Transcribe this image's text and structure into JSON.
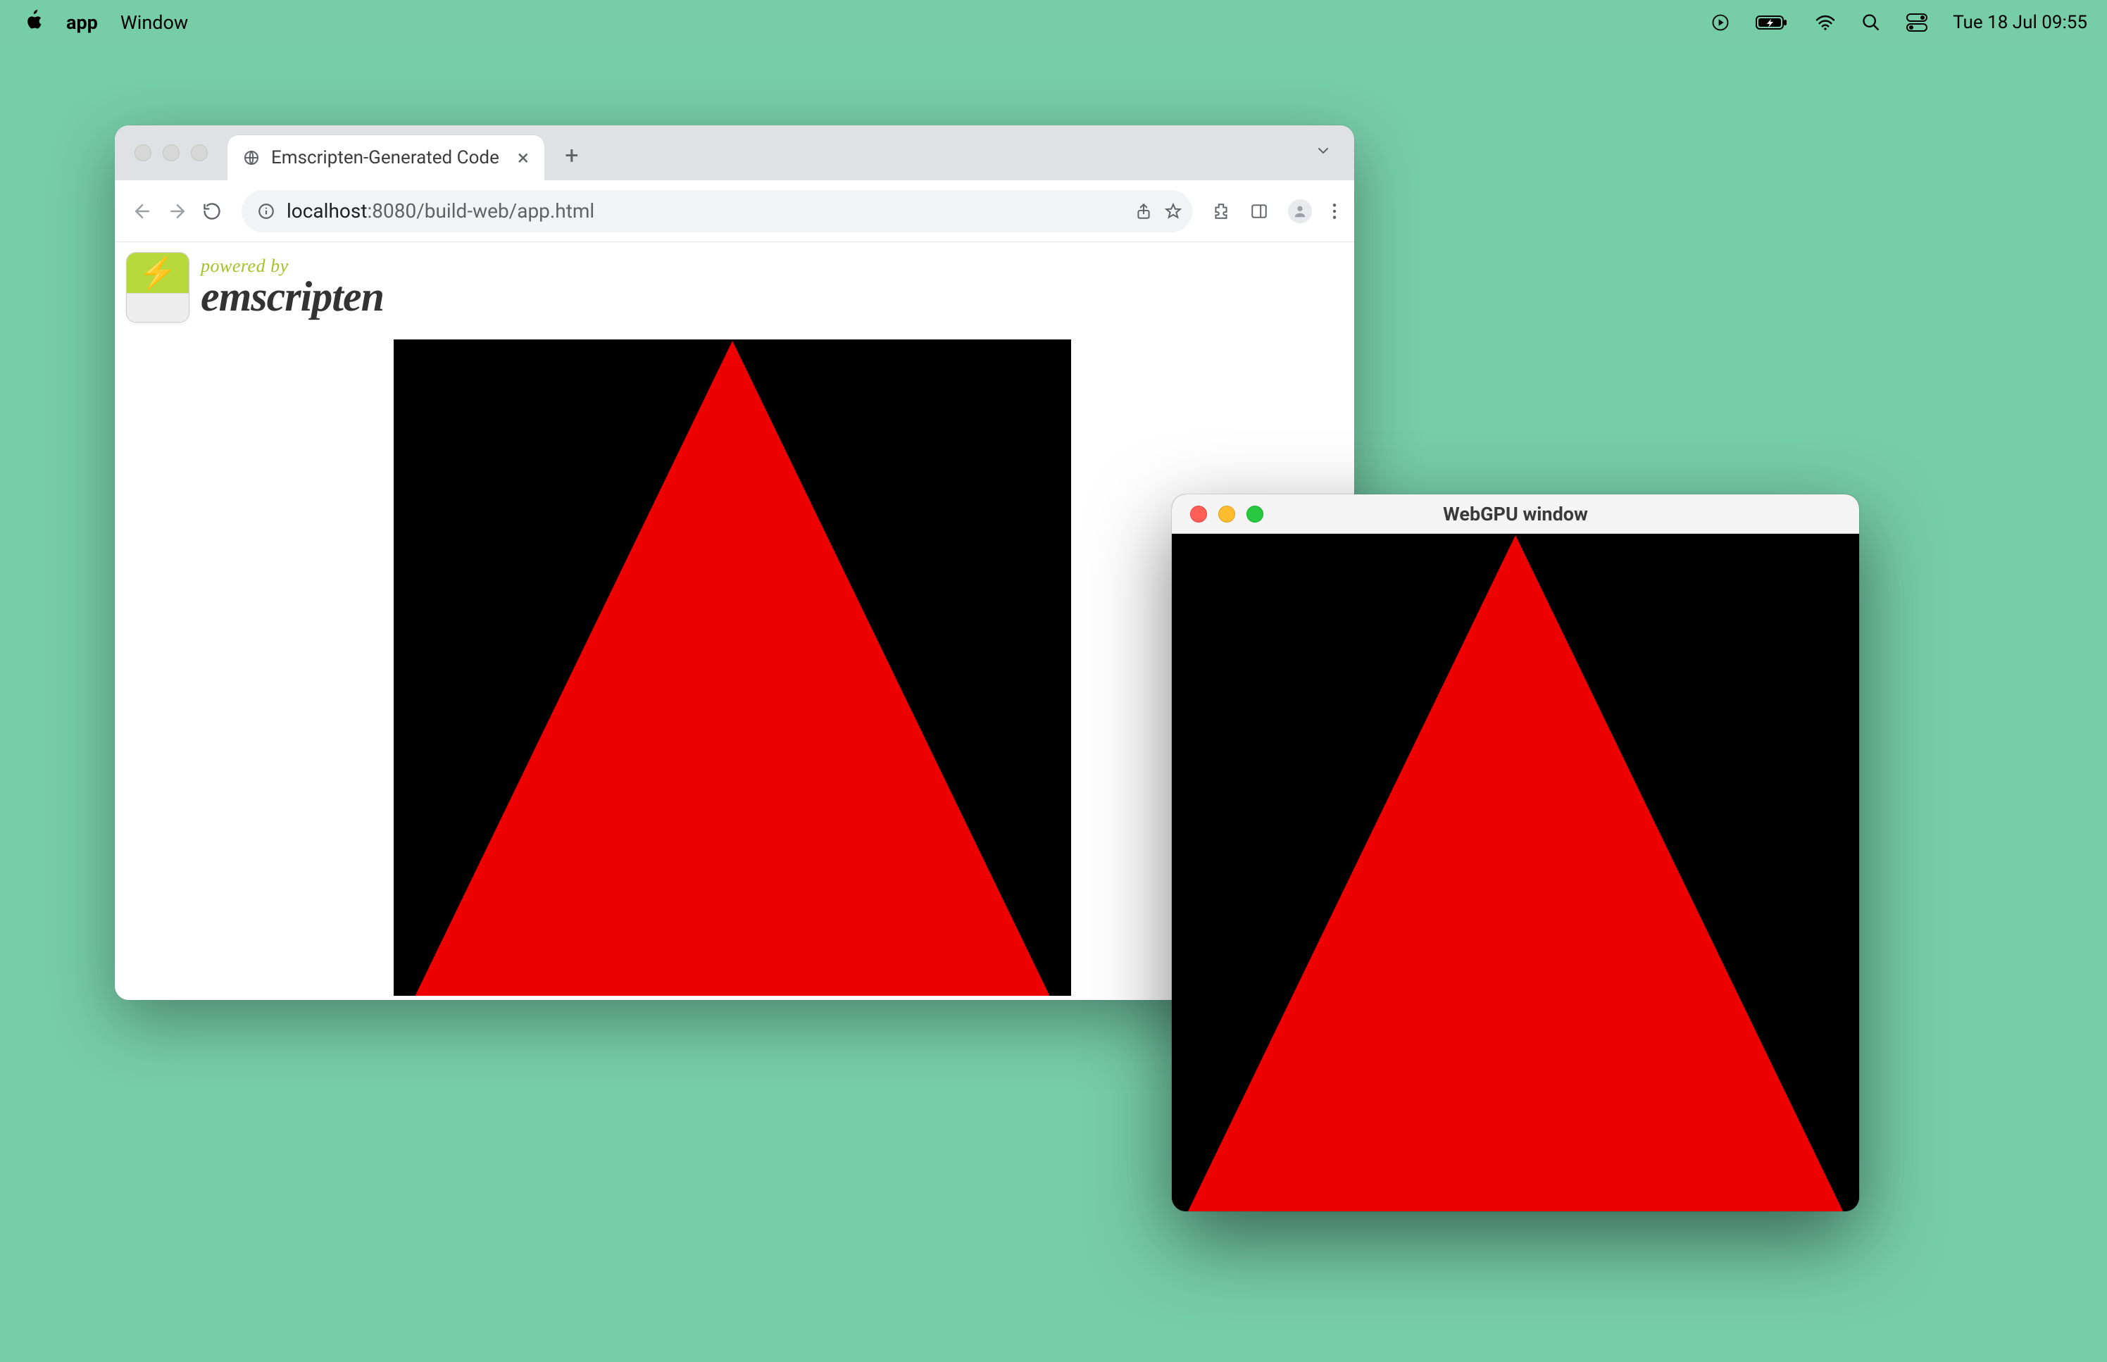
{
  "menubar": {
    "app": "app",
    "window": "Window",
    "time": "Tue 18 Jul  09:55"
  },
  "chrome": {
    "tab_title": "Emscripten-Generated Code",
    "url_host": "localhost",
    "url_path": ":8080/build-web/app.html"
  },
  "emscripten": {
    "powered_by": "powered by",
    "name": "emscripten"
  },
  "native": {
    "title": "WebGPU window"
  }
}
